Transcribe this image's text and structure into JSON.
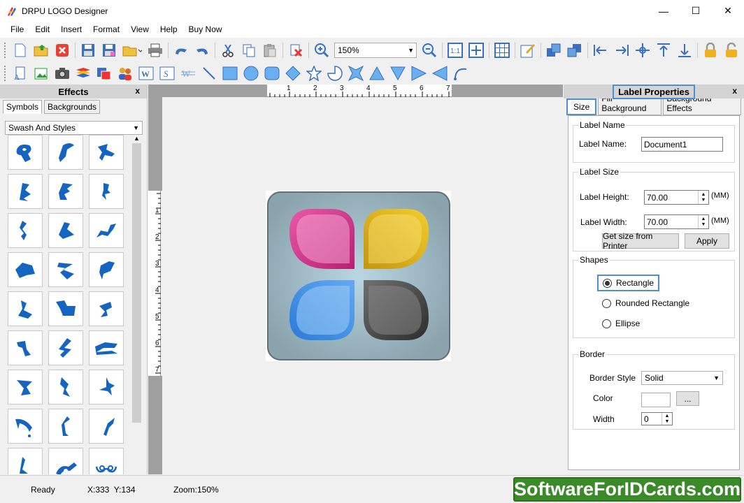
{
  "window": {
    "title": "DRPU LOGO Designer"
  },
  "menu": [
    "File",
    "Edit",
    "Insert",
    "Format",
    "View",
    "Help",
    "Buy Now"
  ],
  "toolbar": {
    "zoom": "150%"
  },
  "effects_panel": {
    "title": "Effects",
    "close": "x",
    "tabs": [
      "Symbols",
      "Backgrounds"
    ],
    "category": "Swash And Styles"
  },
  "ruler": {
    "top": [
      "1",
      "2",
      "3",
      "4",
      "5",
      "6",
      "7"
    ],
    "left": [
      "1",
      "2",
      "3",
      "4",
      "5",
      "6",
      "7"
    ]
  },
  "label_properties": {
    "title": "Label Properties",
    "close": "x",
    "tabs": [
      "Size",
      "Fill Background",
      "Background Effects"
    ],
    "label_name_group": "Label Name",
    "label_name_label": "Label Name:",
    "label_name_value": "Document1",
    "label_size_group": "Label Size",
    "height_label": "Label Height:",
    "height_value": "70.00",
    "width_label": "Label Width:",
    "width_value": "70.00",
    "unit": "(MM)",
    "get_size_btn": "Get size from Printer",
    "apply_btn": "Apply",
    "shapes_group": "Shapes",
    "shapes": [
      "Rectangle",
      "Rounded Rectangle",
      "Ellipse"
    ],
    "selected_shape": "Rectangle",
    "border_group": "Border",
    "border_style_label": "Border Style",
    "border_style_value": "Solid",
    "color_label": "Color",
    "color_btn": "...",
    "width_border_label": "Width",
    "width_border_value": "0"
  },
  "status": {
    "ready": "Ready",
    "coords": "X:333  Y:134",
    "zoom": "Zoom:150%"
  },
  "watermark": "SoftwareForIDCards.com",
  "colors": {
    "accent_blue": "#4a90d9",
    "symbol_blue": "#1565c0",
    "magenta": "#d9388f",
    "yellow": "#e6b81d",
    "blue": "#3a8ee6",
    "dark": "#4a4a4a"
  }
}
